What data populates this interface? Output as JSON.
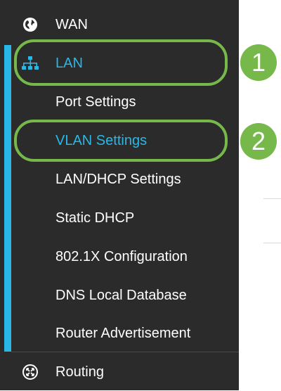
{
  "sidebar": {
    "items": [
      {
        "label": "WAN",
        "icon": "globe-icon"
      },
      {
        "label": "LAN",
        "icon": "network-tree-icon"
      },
      {
        "label": "Port Settings"
      },
      {
        "label": "VLAN Settings"
      },
      {
        "label": "LAN/DHCP Settings"
      },
      {
        "label": "Static DHCP"
      },
      {
        "label": "802.1X Configuration"
      },
      {
        "label": "DNS Local Database"
      },
      {
        "label": "Router Advertisement"
      },
      {
        "label": "Routing",
        "icon": "routing-arrows-icon"
      }
    ]
  },
  "callouts": {
    "step1": "1",
    "step2": "2"
  },
  "colors": {
    "sidebar_bg": "#2b2b2b",
    "accent": "#29b8e6",
    "callout_green": "#76b84a"
  }
}
